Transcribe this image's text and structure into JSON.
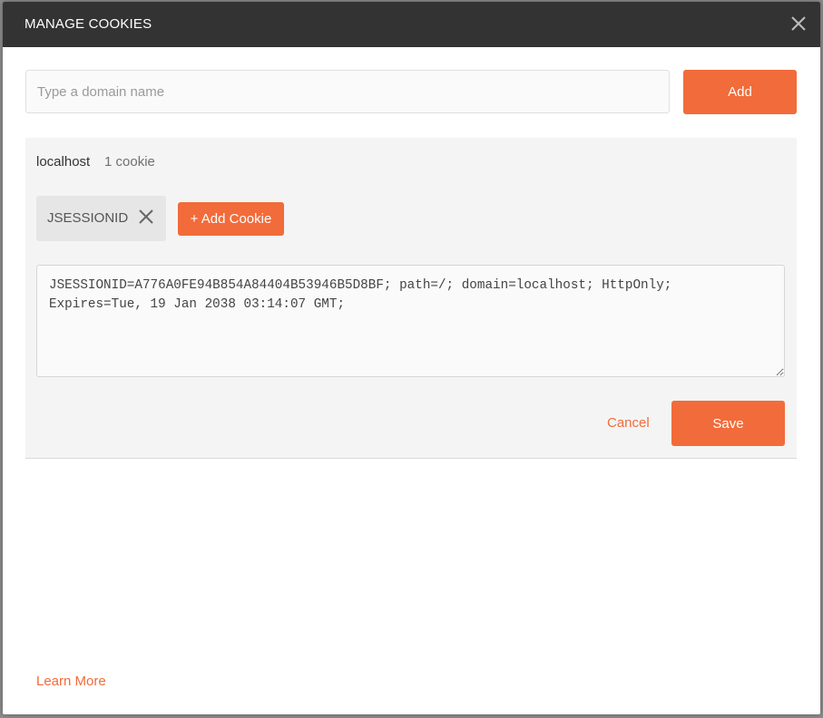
{
  "modal": {
    "title": "MANAGE COOKIES",
    "close_icon": "close-icon"
  },
  "domain_form": {
    "placeholder": "Type a domain name",
    "value": "",
    "add_label": "Add"
  },
  "domains": [
    {
      "name": "localhost",
      "count_label": "1 cookie",
      "cookies": [
        {
          "name": "JSESSIONID",
          "remove_icon": "close-icon"
        }
      ],
      "add_cookie_label": "+ Add Cookie",
      "editor_value": "JSESSIONID=A776A0FE94B854A84404B53946B5D8BF; path=/; domain=localhost; HttpOnly; Expires=Tue, 19 Jan 2038 03:14:07 GMT;",
      "cancel_label": "Cancel",
      "save_label": "Save"
    }
  ],
  "footer": {
    "learn_more_label": "Learn More"
  },
  "colors": {
    "accent": "#f26b3a",
    "header_bg": "#333333",
    "panel_bg": "#f4f4f4"
  }
}
